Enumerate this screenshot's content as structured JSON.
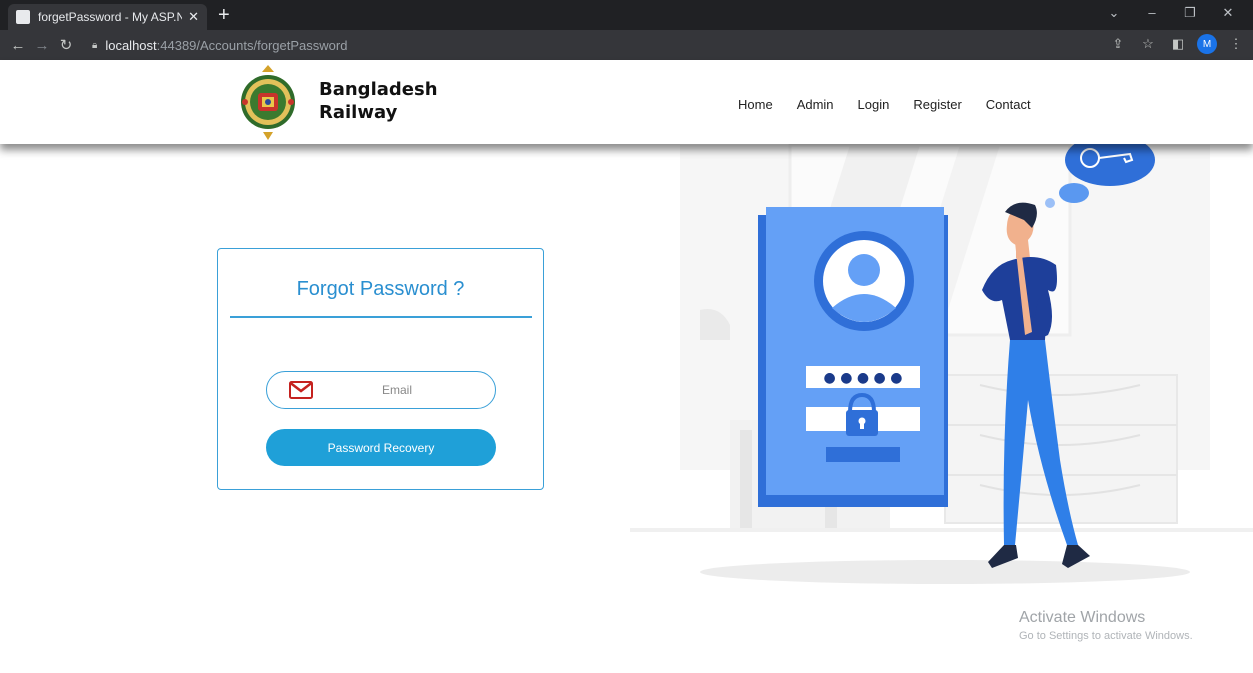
{
  "browser": {
    "tab_title": "forgetPassword - My ASP.NET Ap",
    "tab_close": "✕",
    "new_tab": "+",
    "url_host": "localhost",
    "url_path": ":44389/Accounts/forgetPassword",
    "profile_initial": "M",
    "window_controls": {
      "chevron": "⌄",
      "minimize": "–",
      "restore": "❐",
      "close": "✕"
    }
  },
  "header": {
    "brand_line1": "Bangladesh",
    "brand_line2": "Railway",
    "nav": [
      "Home",
      "Admin",
      "Login",
      "Register",
      "Contact"
    ]
  },
  "form": {
    "title": "Forgot Password ?",
    "email_placeholder": "Email",
    "email_value": "",
    "submit_label": "Password Recovery"
  },
  "illustration": {
    "password_dots": "● ● ● ● ●"
  },
  "watermark": {
    "title": "Activate Windows",
    "subtitle": "Go to Settings to activate Windows."
  },
  "colors": {
    "accent": "#1fa0d8",
    "border": "#3aa0d8",
    "illustration_blue": "#4a8bf0",
    "illustration_dark": "#1a3a8a"
  }
}
